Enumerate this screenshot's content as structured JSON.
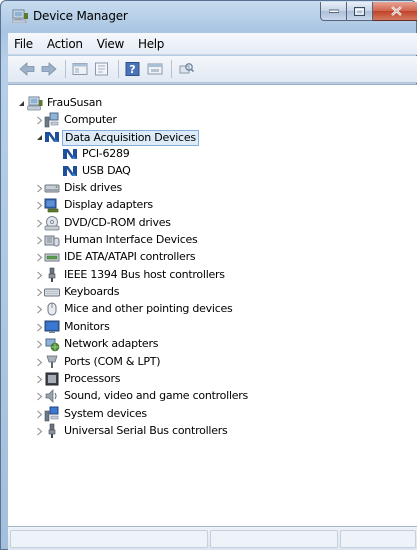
{
  "window": {
    "title": "Device Manager"
  },
  "menu": {
    "items": [
      "File",
      "Action",
      "View",
      "Help"
    ]
  },
  "toolbar": {
    "buttons": [
      "back-icon",
      "forward-icon",
      "show-hide-tree-icon",
      "properties-icon",
      "help-icon",
      "update-driver-icon",
      "scan-hardware-icon"
    ]
  },
  "tree": {
    "root": "FrauSusan",
    "categories": [
      {
        "label": "Computer",
        "expanded": false
      },
      {
        "label": "Data Acquisition Devices",
        "expanded": true,
        "selected": true,
        "children": [
          "PCI-6289",
          "USB DAQ"
        ]
      },
      {
        "label": "Disk drives",
        "expanded": false
      },
      {
        "label": "Display adapters",
        "expanded": false
      },
      {
        "label": "DVD/CD-ROM drives",
        "expanded": false
      },
      {
        "label": "Human Interface Devices",
        "expanded": false
      },
      {
        "label": "IDE ATA/ATAPI controllers",
        "expanded": false
      },
      {
        "label": "IEEE 1394 Bus host controllers",
        "expanded": false
      },
      {
        "label": "Keyboards",
        "expanded": false
      },
      {
        "label": "Mice and other pointing devices",
        "expanded": false
      },
      {
        "label": "Monitors",
        "expanded": false
      },
      {
        "label": "Network adapters",
        "expanded": false
      },
      {
        "label": "Ports (COM & LPT)",
        "expanded": false
      },
      {
        "label": "Processors",
        "expanded": false
      },
      {
        "label": "Sound, video and game controllers",
        "expanded": false
      },
      {
        "label": "System devices",
        "expanded": false
      },
      {
        "label": "Universal Serial Bus controllers",
        "expanded": false
      }
    ]
  },
  "colors": {
    "selection_bg": "#ddebf8",
    "selection_border": "#84acdd",
    "frame": "#a9c5e2",
    "close_button": "#c0432a"
  }
}
